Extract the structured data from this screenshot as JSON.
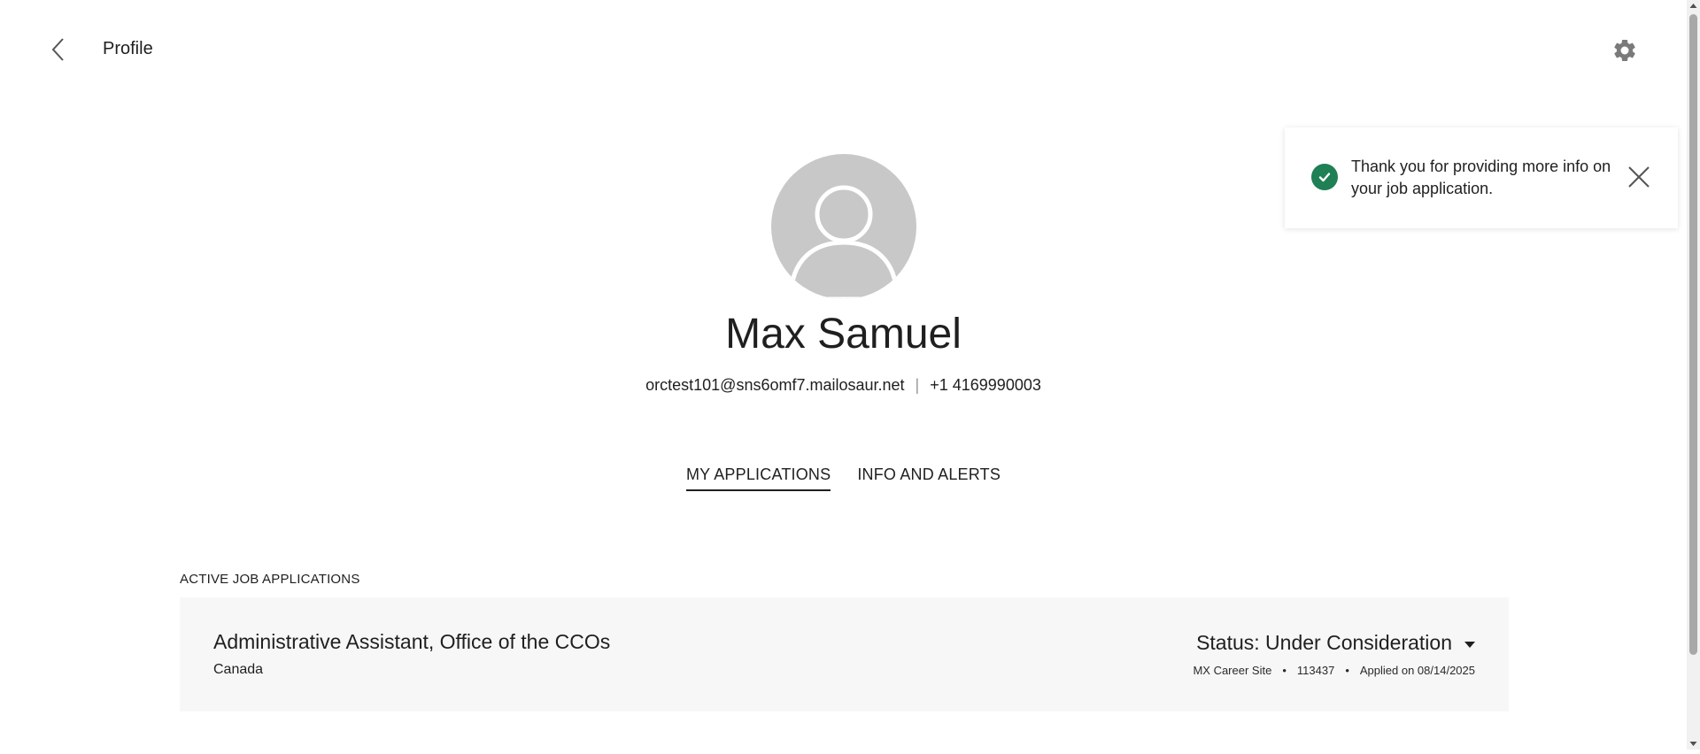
{
  "header": {
    "title": "Profile",
    "back_icon": "chevron-left-icon",
    "settings_icon": "gear-icon"
  },
  "profile": {
    "name": "Max Samuel",
    "email": "orctest101@sns6omf7.mailosaur.net",
    "separator": "|",
    "phone": "+1 4169990003",
    "avatar_icon": "person-avatar-icon"
  },
  "tabs": [
    {
      "label": "MY APPLICATIONS",
      "active": true
    },
    {
      "label": "INFO AND ALERTS",
      "active": false
    }
  ],
  "applications": {
    "section_label": "ACTIVE JOB APPLICATIONS",
    "items": [
      {
        "title": "Administrative Assistant, Office of the CCOs",
        "location": "Canada",
        "status": "Status: Under Consideration",
        "site": "MX Career Site",
        "req_id": "113437",
        "applied": "Applied on 08/14/2025",
        "bullet": "•"
      }
    ]
  },
  "toast": {
    "message": "Thank you for providing more info on your job application.",
    "icon": "check-circle-icon",
    "close_icon": "close-icon",
    "accent_color": "#1f7f55"
  },
  "colors": {
    "text": "#1f1f1f",
    "avatar_bg": "#c8c8c8",
    "card_bg": "#f7f7f7"
  }
}
